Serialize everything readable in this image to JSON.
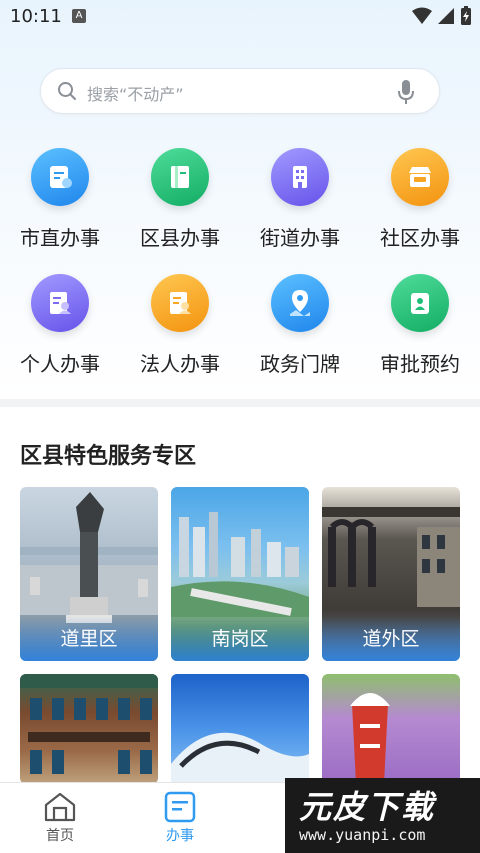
{
  "status_bar": {
    "time": "10:11",
    "notification_badge": "A"
  },
  "search": {
    "placeholder": "搜索“不动产”"
  },
  "services": [
    {
      "label": "市直办事",
      "icon": "document-icon",
      "color": "#2f9bf0"
    },
    {
      "label": "区县办事",
      "icon": "book-icon",
      "color": "#1fbf7a"
    },
    {
      "label": "街道办事",
      "icon": "building-icon",
      "color": "#7b6cf0"
    },
    {
      "label": "社区办事",
      "icon": "shop-icon",
      "color": "#f6a623"
    },
    {
      "label": "个人办事",
      "icon": "person-card-icon",
      "color": "#7b6cf0"
    },
    {
      "label": "法人办事",
      "icon": "corporate-card-icon",
      "color": "#f6a623"
    },
    {
      "label": "政务门牌",
      "icon": "map-pin-icon",
      "color": "#2f9bf0"
    },
    {
      "label": "审批预约",
      "icon": "approval-icon",
      "color": "#1fbf7a"
    }
  ],
  "section": {
    "title": "区县特色服务专区"
  },
  "districts": [
    {
      "label": "道里区"
    },
    {
      "label": "南岗区"
    },
    {
      "label": "道外区"
    },
    {
      "label": ""
    },
    {
      "label": ""
    },
    {
      "label": ""
    }
  ],
  "bottom_nav": [
    {
      "label": "首页",
      "icon": "home-icon",
      "active": false
    },
    {
      "label": "办事",
      "icon": "service-icon",
      "active": true
    }
  ],
  "watermark": {
    "big": "元皮下载",
    "small": "www.yuanpi.com"
  },
  "colors": {
    "accent": "#2f9bf0",
    "nav_active": "#2f9bf0",
    "nav_inactive": "#555555"
  }
}
